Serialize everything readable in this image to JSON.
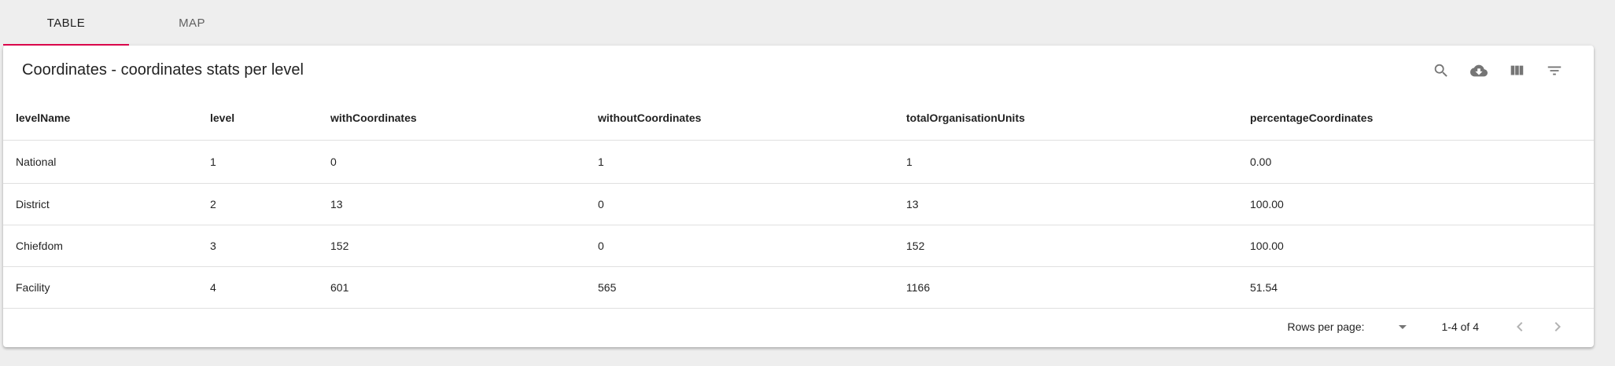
{
  "tabs": [
    {
      "label": "TABLE",
      "active": true
    },
    {
      "label": "MAP",
      "active": false
    }
  ],
  "title": "Coordinates - coordinates stats per level",
  "toolbar": {
    "icons": [
      "search-icon",
      "cloud-download-icon",
      "view-column-icon",
      "filter-list-icon"
    ]
  },
  "table": {
    "columns": [
      "levelName",
      "level",
      "withCoordinates",
      "withoutCoordinates",
      "totalOrganisationUnits",
      "percentageCoordinates"
    ],
    "rows": [
      [
        "National",
        "1",
        "0",
        "1",
        "1",
        "0.00"
      ],
      [
        "District",
        "2",
        "13",
        "0",
        "13",
        "100.00"
      ],
      [
        "Chiefdom",
        "3",
        "152",
        "0",
        "152",
        "100.00"
      ],
      [
        "Facility",
        "4",
        "601",
        "565",
        "1166",
        "51.54"
      ]
    ]
  },
  "pagination": {
    "rows_per_page_label": "Rows per page:",
    "rows_per_page_value": "",
    "range": "1-4 of 4"
  },
  "colors": {
    "tab_indicator": "#e0004d",
    "background": "#eeeeee"
  }
}
